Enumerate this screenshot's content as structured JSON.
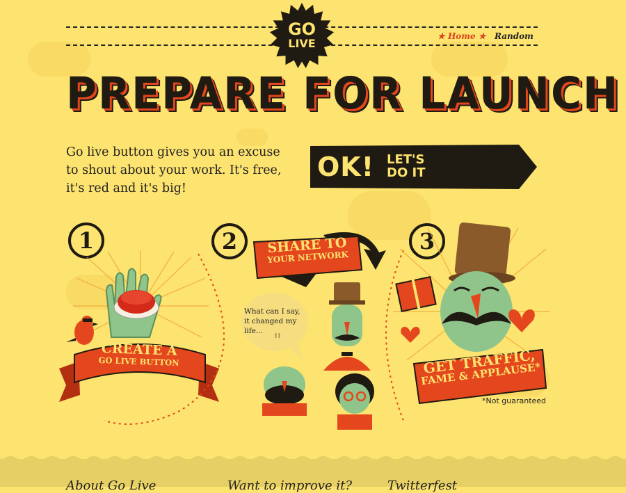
{
  "header": {
    "logo_line1": "GO",
    "logo_line2": "LIVE",
    "nav": [
      {
        "label": "Home",
        "active": true
      },
      {
        "label": "Random",
        "active": false
      }
    ]
  },
  "hero": {
    "title": "PREPARE FOR LAUNCH",
    "intro": "Go live button gives you an excuse to shout about your work. It's free, it's red and it's big!",
    "cta_main": "OK!",
    "cta_line1": "LET'S",
    "cta_line2": "DO IT"
  },
  "steps": [
    {
      "number": "1",
      "banner_line1": "CREATE A",
      "banner_line2": "GO LIVE BUTTON"
    },
    {
      "number": "2",
      "banner_line1": "SHARE TO",
      "banner_line2": "YOUR NETWORK",
      "speech": "What can I say, it changed my life..."
    },
    {
      "number": "3",
      "banner_line1": "GET TRAFFIC,",
      "banner_line2": "FAME & APPLAUSE*"
    }
  ],
  "footnote": "*Not guaranteed",
  "footer": {
    "headings": [
      "About Go Live",
      "Want to improve it?",
      "Twitterfest"
    ]
  },
  "colors": {
    "background": "#fde36f",
    "ink": "#1f1a12",
    "accent": "#e4471d",
    "face_green": "#8fc58a"
  }
}
